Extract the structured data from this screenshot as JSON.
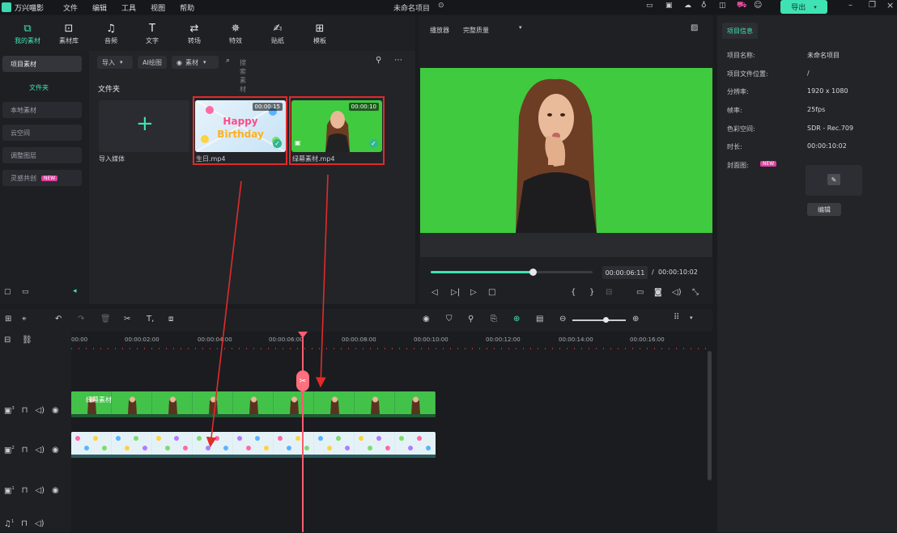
{
  "topbar": {
    "app_name": "万兴喵影",
    "menu": [
      "文件",
      "编辑",
      "工具",
      "视图",
      "帮助"
    ],
    "doc_title": "未命名项目",
    "export_label": "导出"
  },
  "media_toolbar": {
    "tools": [
      {
        "label": "我的素材",
        "icon": "folder-icon"
      },
      {
        "label": "素材库",
        "icon": "library-icon"
      },
      {
        "label": "音频",
        "icon": "music-note-icon"
      },
      {
        "label": "文字",
        "icon": "text-icon"
      },
      {
        "label": "转场",
        "icon": "transition-icon"
      },
      {
        "label": "特效",
        "icon": "effects-icon"
      },
      {
        "label": "贴纸",
        "icon": "sticker-icon"
      },
      {
        "label": "模板",
        "icon": "template-icon"
      }
    ]
  },
  "sidebar": {
    "items": [
      {
        "label": "项目素材"
      },
      {
        "label": "本地素材"
      },
      {
        "label": "云空间"
      },
      {
        "label": "调整图层"
      },
      {
        "label": "灵感共创",
        "badge": "NEW"
      }
    ],
    "folder": "文件夹"
  },
  "media_filter": {
    "import": "导入",
    "ai_image": "AI绘图",
    "media": "素材",
    "search_placeholder": "搜索素材"
  },
  "media_grid": {
    "heading": "文件夹",
    "import_label": "导入媒体",
    "clips": [
      {
        "name": "生日.mp4",
        "duration": "00:00:15"
      },
      {
        "name": "绿幕素材.mp4",
        "duration": "00:00:10"
      }
    ]
  },
  "preview": {
    "player": "播放器",
    "quality": "完整质量",
    "time_current": "00:00:06:11",
    "time_separator": "/",
    "time_total": "00:00:10:02",
    "progress_fraction": 0.63
  },
  "properties": {
    "tab": "项目信息",
    "rows": [
      {
        "label": "项目名称:",
        "value": "未命名项目"
      },
      {
        "label": "项目文件位置:",
        "value": "/"
      },
      {
        "label": "分辨率:",
        "value": "1920 x 1080"
      },
      {
        "label": "帧率:",
        "value": "25fps"
      },
      {
        "label": "色彩空间:",
        "value": "SDR - Rec.709"
      },
      {
        "label": "时长:",
        "value": "00:00:10:02"
      },
      {
        "label": "封面图:",
        "value": ""
      }
    ],
    "cover_badge": "NEW",
    "edit_label": "编辑"
  },
  "timeline": {
    "ticks": [
      "00:00",
      "00:00:02:00",
      "00:00:04:00",
      "00:00:06:00",
      "00:00:08:00",
      "00:00:10:00",
      "00:00:12:00",
      "00:00:14:00",
      "00:00:16:00"
    ],
    "green_clip_label": "绿幕素材",
    "tracks": [
      "3",
      "2",
      "1",
      "1"
    ]
  },
  "colors": {
    "accent": "#3fe2b3",
    "selection_red": "#e02b2b",
    "playhead": "#ff5c6f",
    "greenscreen": "#3fca3f"
  }
}
